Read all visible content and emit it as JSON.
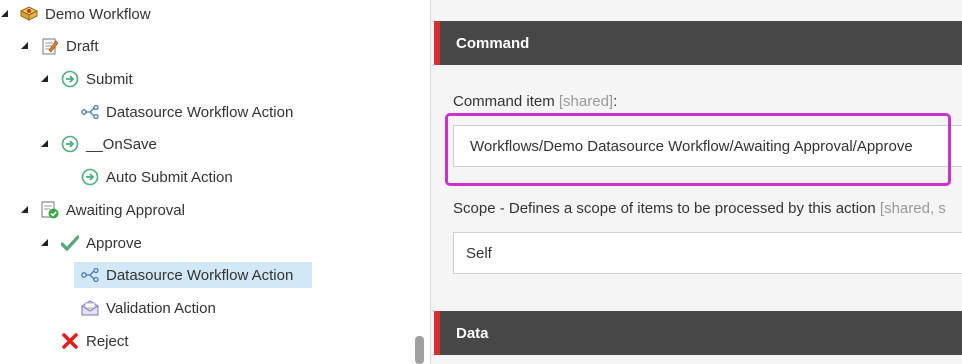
{
  "tree": {
    "demo_workflow": "Demo Workflow",
    "draft": "Draft",
    "submit": "Submit",
    "submit_action": "Datasource Workflow Action",
    "onsave": "__OnSave",
    "auto_submit": "Auto Submit Action",
    "awaiting": "Awaiting Approval",
    "approve": "Approve",
    "approve_action": "Datasource Workflow Action",
    "validation": "Validation Action",
    "reject": "Reject"
  },
  "form": {
    "command_section": "Command",
    "command_item_label": "Command item",
    "command_item_meta": "[shared]",
    "command_item_colon": ":",
    "command_item_value": "Workflows/Demo Datasource Workflow/Awaiting Approval/Approve",
    "scope_label": "Scope - Defines a scope of items to be processed by this action",
    "scope_meta": "[shared, s",
    "scope_value": "Self",
    "data_section": "Data"
  },
  "colors": {
    "header_bg": "#474747",
    "header_accent": "#d32f2f",
    "highlight": "#cc33cc",
    "selected_bg": "#d2e8f6"
  }
}
